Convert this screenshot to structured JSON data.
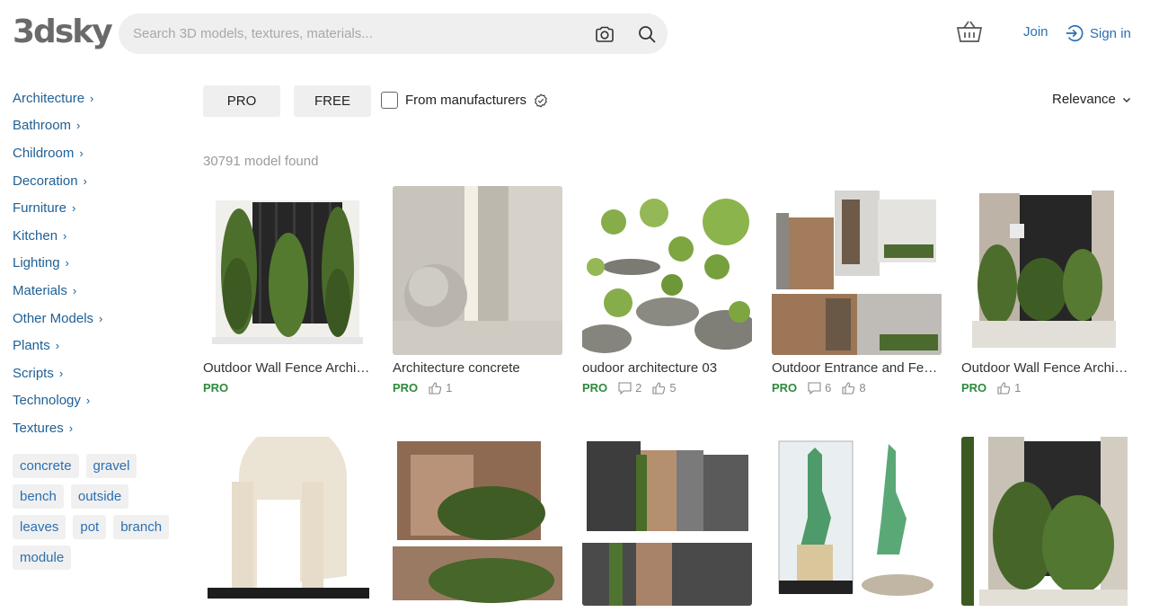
{
  "header": {
    "logo": "3dsky",
    "search_placeholder": "Search 3D models, textures, materials...",
    "join": "Join",
    "signin": "Sign in"
  },
  "sidebar": {
    "categories": [
      {
        "label": "Architecture"
      },
      {
        "label": "Bathroom"
      },
      {
        "label": "Childroom"
      },
      {
        "label": "Decoration"
      },
      {
        "label": "Furniture"
      },
      {
        "label": "Kitchen"
      },
      {
        "label": "Lighting"
      },
      {
        "label": "Materials"
      },
      {
        "label": "Other Models"
      },
      {
        "label": "Plants"
      },
      {
        "label": "Scripts"
      },
      {
        "label": "Technology"
      },
      {
        "label": "Textures"
      }
    ],
    "tags": [
      "concrete",
      "gravel",
      "bench",
      "outside",
      "leaves",
      "pot",
      "branch",
      "module"
    ]
  },
  "filters": {
    "pro": "PRO",
    "free": "FREE",
    "manufacturers": "From manufacturers",
    "sort": "Relevance"
  },
  "results": {
    "count": "30791 model found",
    "items": [
      {
        "title": "Outdoor Wall Fence Architecture",
        "badge": "PRO"
      },
      {
        "title": "Architecture concrete",
        "badge": "PRO",
        "likes": "1"
      },
      {
        "title": "oudoor architecture 03",
        "badge": "PRO",
        "comments": "2",
        "likes": "5"
      },
      {
        "title": "Outdoor Entrance and Fence",
        "badge": "PRO",
        "comments": "6",
        "likes": "8"
      },
      {
        "title": "Outdoor Wall Fence Architecture",
        "badge": "PRO",
        "likes": "1"
      },
      {
        "title": ""
      },
      {
        "title": ""
      },
      {
        "title": ""
      },
      {
        "title": ""
      },
      {
        "title": ""
      }
    ]
  },
  "colors": {
    "link": "#2a6fb3",
    "category": "#1f5f94",
    "pro": "#2e8a3a",
    "pill_bg": "#efefef"
  }
}
